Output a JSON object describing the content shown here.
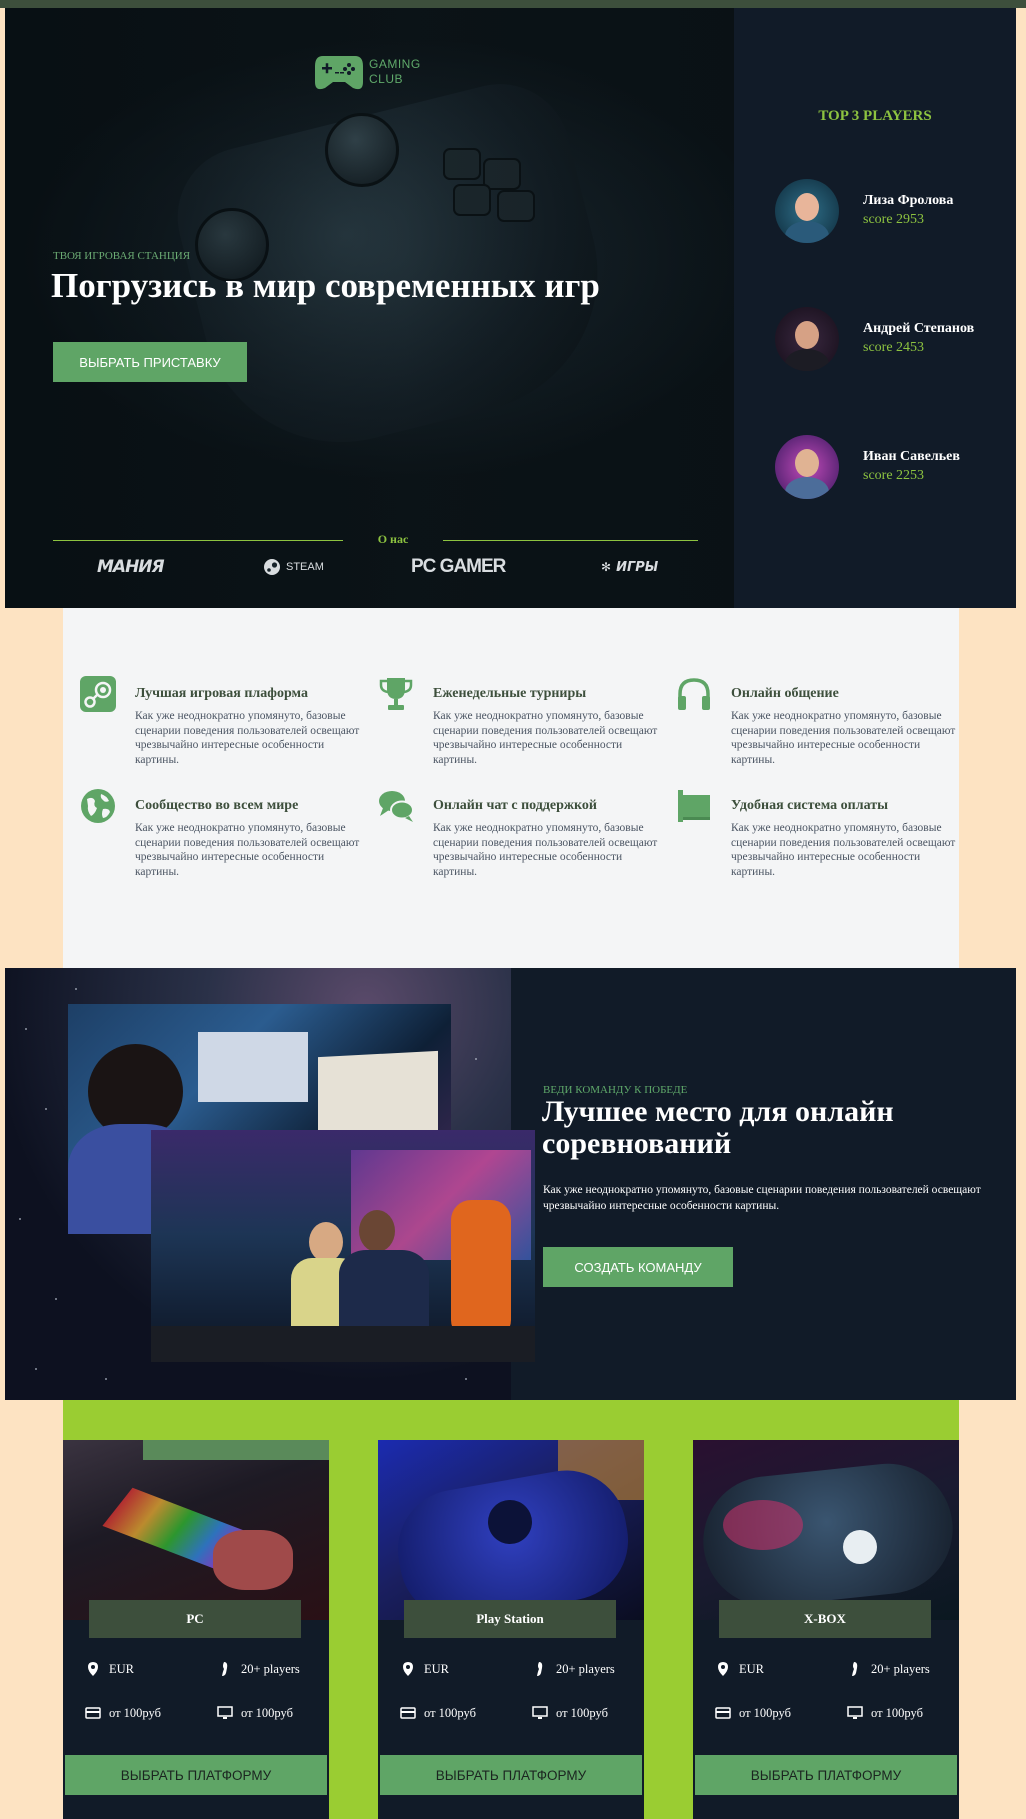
{
  "brand": {
    "logo_line1": "GAMING",
    "logo_line2": "CLUB"
  },
  "hero": {
    "eyebrow": "ТВОЯ ИГРОВАЯ СТАНЦИЯ",
    "title": "Погрузись в мир современных игр",
    "button": "ВЫБРАТЬ ПРИСТАВКУ",
    "about_label": "О нас",
    "partners": [
      "МАНИЯ",
      "STEAM",
      "PC GAMER",
      "ИГРЫ"
    ]
  },
  "top_players": {
    "title": "TOP 3 PLAYERS",
    "players": [
      {
        "name": "Лиза Фролова",
        "score": "score 2953"
      },
      {
        "name": "Андрей Степанов",
        "score": "score 2453"
      },
      {
        "name": "Иван Савельев",
        "score": "score 2253"
      }
    ]
  },
  "features": [
    {
      "icon": "steam-icon",
      "title": "Лучшая игровая плаформа",
      "text": "Как уже неоднократно упомянуто, базовые сценарии поведения пользователей освещают чрезвычайно интересные особенности картины."
    },
    {
      "icon": "trophy-icon",
      "title": "Еженедельные турниры",
      "text": "Как уже неоднократно упомянуто, базовые сценарии поведения пользователей освещают чрезвычайно интересные особенности картины."
    },
    {
      "icon": "headphones-icon",
      "title": "Онлайн общение",
      "text": "Как уже неоднократно упомянуто, базовые сценарии поведения пользователей освещают чрезвычайно интересные особенности картины."
    },
    {
      "icon": "globe-icon",
      "title": "Сообщество во всем мире",
      "text": "Как уже неоднократно упомянуто, базовые сценарии поведения пользователей освещают чрезвычайно интересные особенности картины."
    },
    {
      "icon": "chat-icon",
      "title": "Онлайн чат с поддержкой",
      "text": "Как уже неоднократно упомянуто, базовые сценарии поведения пользователей освещают чрезвычайно интересные особенности картины."
    },
    {
      "icon": "payment-icon",
      "title": "Удобная система оплаты",
      "text": "Как уже неоднократно упомянуто, базовые сценарии поведения пользователей освещают чрезвычайно интересные особенности картины."
    }
  ],
  "competition": {
    "eyebrow": "ВЕДИ КОМАНДУ К ПОБЕДЕ",
    "title": "Лучшее место для онлайн соревнований",
    "text": "Как уже неоднократно упомянуто, базовые сценарии поведения пользователей освещают чрезвычайно интересные особенности картины.",
    "button": "СОЗДАТЬ КОМАНДУ"
  },
  "platforms": [
    {
      "name": "PC",
      "location": "EUR",
      "players": "20+ players",
      "price1": "от 100руб",
      "price2": "от 100руб",
      "button": "ВЫБРАТЬ ПЛАТФОРМУ"
    },
    {
      "name": "Play Station",
      "location": "EUR",
      "players": "20+ players",
      "price1": "от 100руб",
      "price2": "от 100руб",
      "button": "ВЫБРАТЬ ПЛАТФОРМУ"
    },
    {
      "name": "X-BOX",
      "location": "EUR",
      "players": "20+ players",
      "price1": "от 100руб",
      "price2": "от 100руб",
      "button": "ВЫБРАТЬ ПЛАТФОРМУ"
    }
  ],
  "colors": {
    "accent": "#5fa566",
    "lime": "#8dc340",
    "navy": "#111b28",
    "olive": "#3d4f3c",
    "peach": "#fde3c2"
  }
}
